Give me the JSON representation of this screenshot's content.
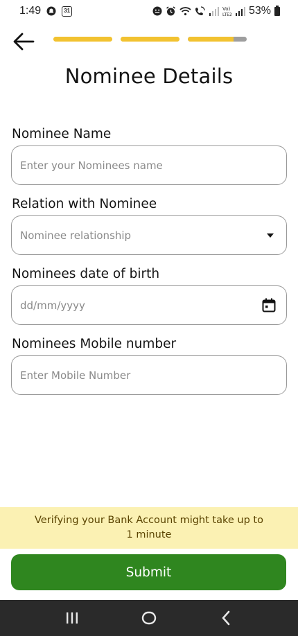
{
  "status_bar": {
    "time": "1:49",
    "calendar_day": "31",
    "battery_percent": "53%",
    "network_label": "Vo)\nLTE2"
  },
  "header": {
    "progress_steps": [
      1,
      1,
      0.78
    ],
    "title": "Nominee Details"
  },
  "form": {
    "nominee_name": {
      "label": "Nominee Name",
      "placeholder": "Enter your Nominees name",
      "value": ""
    },
    "relation": {
      "label": "Relation with Nominee",
      "placeholder": "Nominee relationship"
    },
    "dob": {
      "label": "Nominees date of birth",
      "placeholder": "dd/mm/yyyy",
      "value": ""
    },
    "mobile": {
      "label": "Nominees Mobile number",
      "placeholder": "Enter Mobile Number",
      "value": ""
    }
  },
  "info_banner": {
    "line1": "Verifying your Bank Account might take up to",
    "line2": "1 minute"
  },
  "submit_label": "Submit",
  "colors": {
    "accent_yellow": "#f2c230",
    "submit_green": "#2f861f",
    "banner_bg": "#fbf1b3"
  },
  "icons": {
    "back": "arrow-left-icon",
    "dropdown": "caret-down-icon",
    "date": "calendar-icon",
    "nav_recents": "recent-apps-icon",
    "nav_home": "home-icon",
    "nav_back": "back-chevron-icon"
  }
}
